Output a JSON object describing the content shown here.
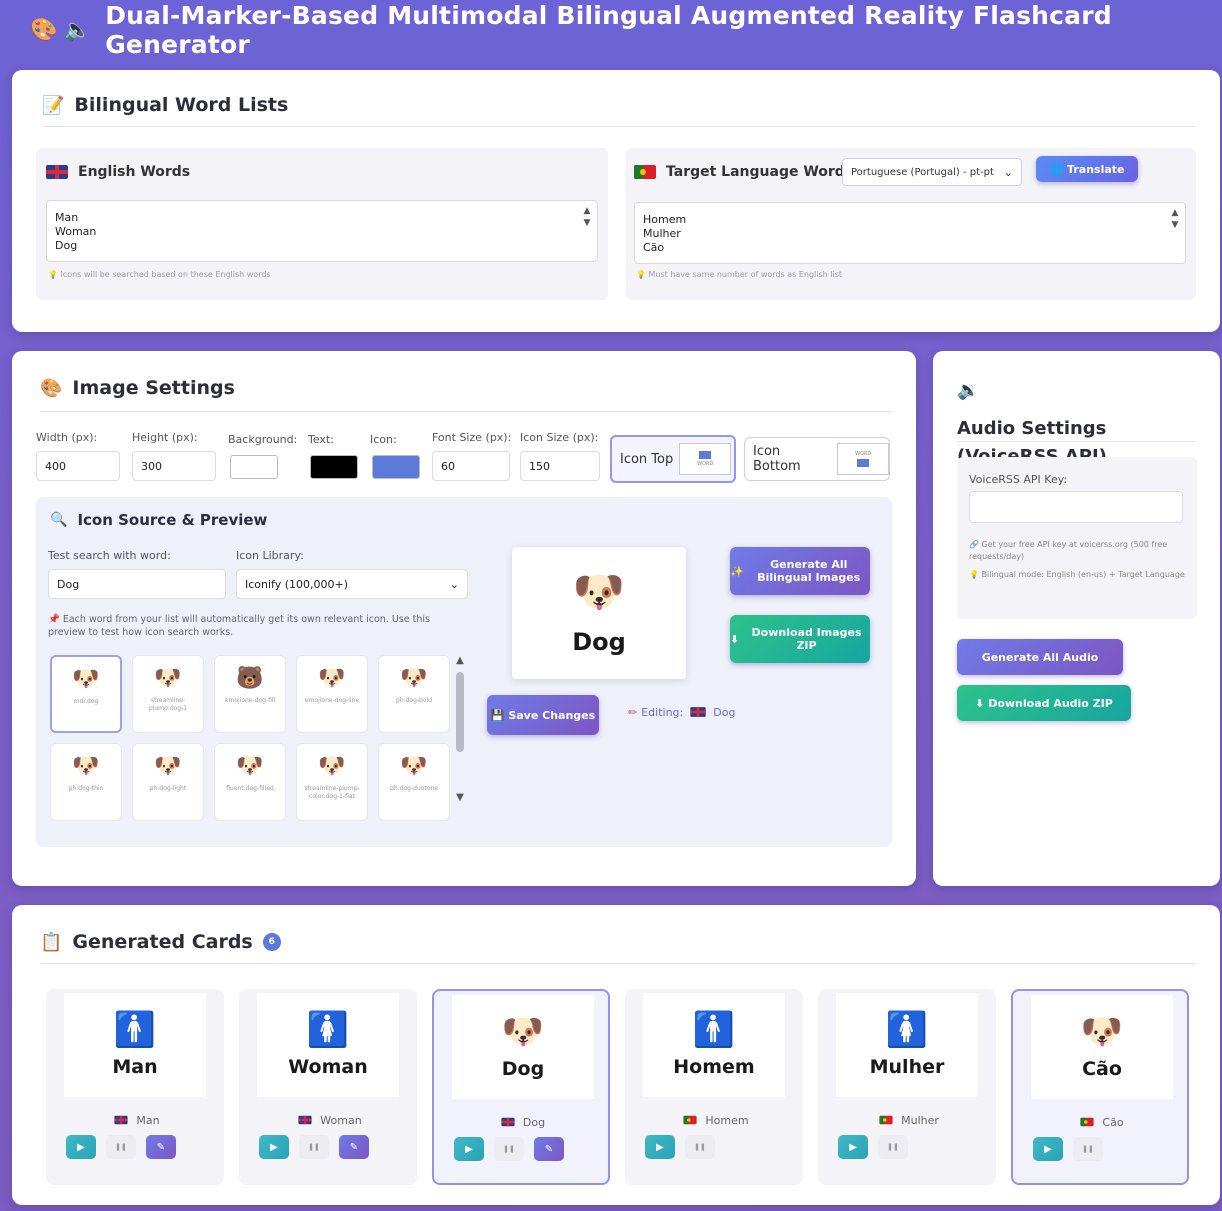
{
  "app": {
    "title": "Dual-Marker-Based Multimodal Bilingual Augmented Reality Flashcard Generator",
    "icons": [
      "palette-icon",
      "speaker-icon"
    ]
  },
  "word_lists": {
    "title": "Bilingual Word Lists",
    "english": {
      "label": "English Words",
      "words": [
        "Man",
        "Woman",
        "Dog"
      ],
      "hint": "Icons will be searched based on these English words"
    },
    "target": {
      "label": "Target Language Words",
      "language_select": "Portuguese (Portugal) - pt-pt",
      "translate_button": "Translate",
      "words": [
        "Homem",
        "Mulher",
        "Cão"
      ],
      "hint": "Must have same number of words as English list"
    }
  },
  "image_settings": {
    "title": "Image Settings",
    "fields": {
      "width_label": "Width (px):",
      "width_value": "400",
      "height_label": "Height (px):",
      "height_value": "300",
      "background_label": "Background:",
      "background_color": "#ffffff",
      "text_label": "Text:",
      "text_color": "#000000",
      "icon_label": "Icon:",
      "icon_color": "#5b7ad9",
      "font_size_label": "Font Size (px):",
      "font_size_value": "60",
      "icon_size_label": "Icon Size (px):",
      "icon_size_value": "150"
    },
    "layout_options": [
      {
        "label": "Icon Top",
        "selected": true
      },
      {
        "label": "Icon Bottom",
        "selected": false
      }
    ],
    "layout_thumb_text": "WORD",
    "icon_source": {
      "title": "Icon Source & Preview",
      "test_label": "Test search with word:",
      "test_value": "Dog",
      "library_label": "Icon Library:",
      "library_value": "Iconify (100,000+)",
      "note": "Each word from your list will automatically get its own relevant icon. Use this preview to test how icon search works.",
      "results": [
        {
          "glyph": "🐶",
          "caption": "mdi:dog",
          "selected": true
        },
        {
          "glyph": "🐶",
          "caption": "streamline-plump:dog-1",
          "selected": false
        },
        {
          "glyph": "🐻",
          "caption": "emojione-dog-fill",
          "selected": false
        },
        {
          "glyph": "🐶",
          "caption": "emojione-dog-line",
          "selected": false
        },
        {
          "glyph": "🐶",
          "caption": "ph:dog-bold",
          "selected": false
        },
        {
          "glyph": "🐶",
          "caption": "ph:dog-thin",
          "selected": false
        },
        {
          "glyph": "🐶",
          "caption": "ph:dog-light",
          "selected": false
        },
        {
          "glyph": "🐶",
          "caption": "fluent:dog-filled",
          "selected": false
        },
        {
          "glyph": "🐶",
          "caption": "streamline-plump-color:dog-1-flat",
          "selected": false
        },
        {
          "glyph": "🐶",
          "caption": "ph:dog-duotone",
          "selected": false
        }
      ]
    },
    "preview": {
      "word": "Dog"
    },
    "save_button": "Save Changes",
    "editing_label": "Editing:",
    "editing_word": "Dog",
    "generate_button": "Generate All Bilingual Images",
    "download_button": "Download Images ZIP"
  },
  "audio": {
    "title": "Audio Settings (VoiceRSS API)",
    "api_key_label": "VoiceRSS API Key:",
    "api_key_value": "",
    "note1": "Get your free API key at voicerss.org (500 free requests/day)",
    "note2": "Bilingual mode: English (en-us) + Target Language",
    "generate_button": "Generate All Audio",
    "download_button": "Download Audio ZIP"
  },
  "generated": {
    "title": "Generated Cards",
    "count_badge": "6",
    "cards": [
      {
        "lang": "en",
        "glyph": "🚹",
        "word": "Man",
        "label": "Man",
        "highlight": false
      },
      {
        "lang": "en",
        "glyph": "🚺",
        "word": "Woman",
        "label": "Woman",
        "highlight": false
      },
      {
        "lang": "en",
        "glyph": "🐶",
        "word": "Dog",
        "label": "Dog",
        "highlight": true
      },
      {
        "lang": "pt",
        "glyph": "🚹",
        "word": "Homem",
        "label": "Homem",
        "highlight": false
      },
      {
        "lang": "pt",
        "glyph": "🚺",
        "word": "Mulher",
        "label": "Mulher",
        "highlight": false
      },
      {
        "lang": "pt",
        "glyph": "🐶",
        "word": "Cão",
        "label": "Cão",
        "highlight": true
      }
    ]
  },
  "colors": {
    "accent": "#6d63d6",
    "green": "#2ec28a",
    "icon_blue": "#5b7ad9"
  }
}
